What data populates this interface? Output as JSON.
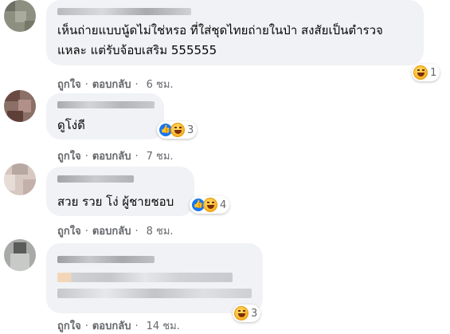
{
  "comments": [
    {
      "text_lines": [
        "เห็นถ่ายแบบนู้ดไม่ใช่หรอ ที่ใส่ชุดไทยถ่ายในป่า สงสัยเป็นตำรวจ",
        "แหละ แต่รับจ้อบเสริม 555555"
      ],
      "reaction_count": "1",
      "reaction_icons": [
        "haha-icon"
      ],
      "like_label": "ถูกใจ",
      "separator": "·",
      "reply_label": "ตอบกลับ",
      "time": "6 ชม."
    },
    {
      "text_lines": [
        "ดูโง่ดี"
      ],
      "reaction_count": "3",
      "reaction_icons": [
        "like-icon",
        "haha-icon"
      ],
      "like_label": "ถูกใจ",
      "separator": "·",
      "reply_label": "ตอบกลับ",
      "time": "7 ชม."
    },
    {
      "text_lines": [
        "สวย รวย โง่ ผู้ชายชอบ"
      ],
      "reaction_count": "4",
      "reaction_icons": [
        "like-icon",
        "haha-icon"
      ],
      "like_label": "ถูกใจ",
      "separator": "·",
      "reply_label": "ตอบกลับ",
      "time": "8 ชม."
    },
    {
      "text_lines": [],
      "reaction_count": "3",
      "reaction_icons": [
        "haha-icon"
      ],
      "like_label": "ถูกใจ",
      "separator": "·",
      "reply_label": "ตอบกลับ",
      "time": "14 ชม."
    }
  ],
  "colors": {
    "bubble": "#f0f2f5",
    "meta": "#65676b",
    "like_blue": "#1877f2",
    "haha_yellow": "#f7b125"
  }
}
